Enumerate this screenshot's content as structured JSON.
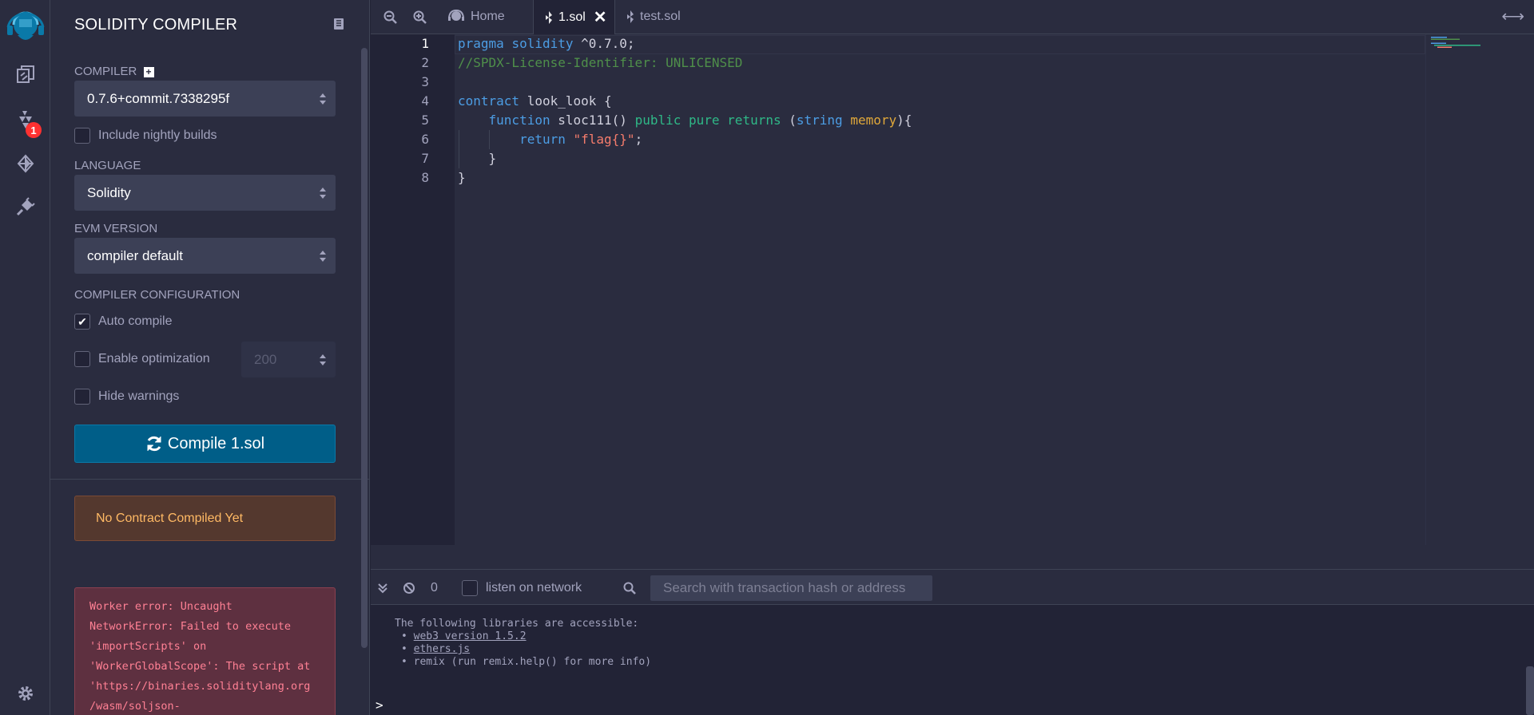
{
  "rail": {
    "badge_count": "1"
  },
  "panel": {
    "title": "SOLIDITY COMPILER",
    "compiler_label": "COMPILER",
    "compiler_value": "0.7.6+commit.7338295f",
    "nightly_label": "Include nightly builds",
    "language_label": "LANGUAGE",
    "language_value": "Solidity",
    "evm_label": "EVM VERSION",
    "evm_value": "compiler default",
    "config_label": "COMPILER CONFIGURATION",
    "auto_compile_label": "Auto compile",
    "auto_compile_checked": true,
    "optimization_label": "Enable optimization",
    "optimization_runs": "200",
    "hide_warnings_label": "Hide warnings",
    "compile_button": "Compile 1.sol",
    "warning": "No Contract Compiled Yet",
    "error": "Worker error: Uncaught\nNetworkError: Failed to execute\n'importScripts' on\n'WorkerGlobalScope': The script at\n'https://binaries.soliditylang.org\n/wasm/soljson-"
  },
  "tabs": [
    {
      "label": "Home"
    },
    {
      "label": "1.sol",
      "active": true
    },
    {
      "label": "test.sol"
    }
  ],
  "editor": {
    "line_numbers": [
      "1",
      "2",
      "3",
      "4",
      "5",
      "6",
      "7",
      "8"
    ],
    "current_line": "1",
    "lines": [
      "pragma solidity ^0.7.0;",
      "//SPDX-License-Identifier: UNLICENSED",
      "",
      "contract look_look {",
      "    function sloc111() public pure returns (string memory){",
      "        return \"flag{}\";",
      "    }",
      "}"
    ]
  },
  "terminal": {
    "pending_count": "0",
    "listen_label": "listen on network",
    "search_placeholder": "Search with transaction hash or address",
    "intro": "The following libraries are accessible:",
    "lib_web3": "web3 version 1.5.2",
    "lib_ethers": "ethers.js",
    "lib_remix": "remix (run remix.help() for more info)",
    "prompt": ">"
  },
  "colors": {
    "background": "#222336",
    "panel": "#2a2c3f",
    "accent": "#005e88",
    "warning_text": "#ffb964",
    "error_text": "#ff8094",
    "badge": "#ff3131"
  }
}
